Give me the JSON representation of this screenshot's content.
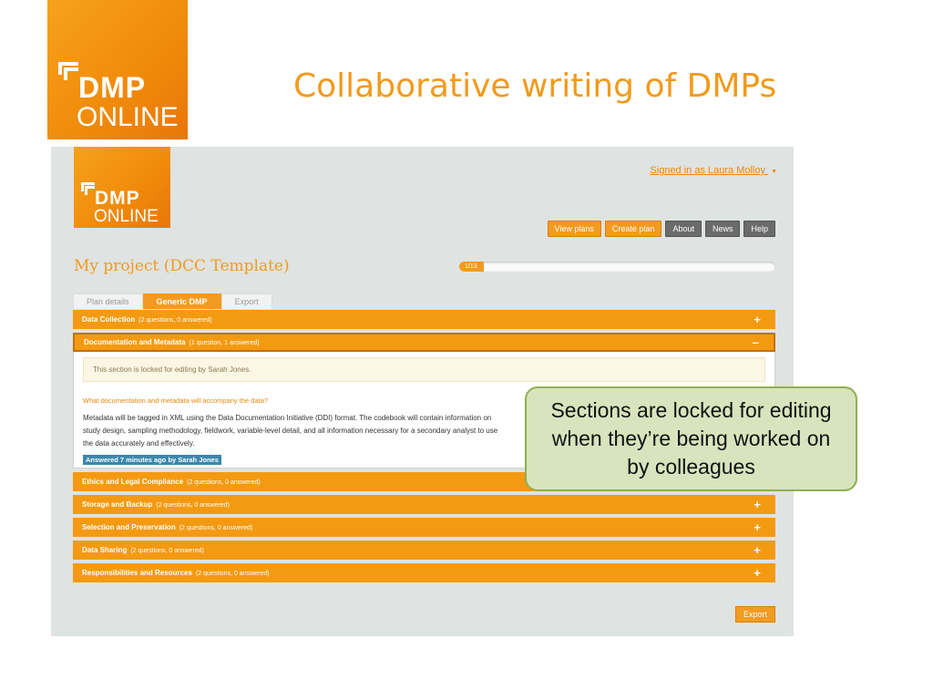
{
  "slide": {
    "title": "Collaborative writing of DMPs",
    "logo": {
      "text_top": "DMP",
      "text_bottom": "ONLINE"
    }
  },
  "screenshot": {
    "logo": {
      "text_top": "DMP",
      "text_bottom": "ONLINE"
    },
    "signed_in": "Signed in as Laura Molloy",
    "nav": [
      {
        "label": "View plans",
        "style": "orange"
      },
      {
        "label": "Create plan",
        "style": "orange"
      },
      {
        "label": "About",
        "style": "grey"
      },
      {
        "label": "News",
        "style": "grey"
      },
      {
        "label": "Help",
        "style": "grey"
      }
    ],
    "project_title": "My project (DCC Template)",
    "progress": {
      "label": "1/13",
      "fraction": 0.077
    },
    "tabs": [
      {
        "label": "Plan details",
        "active": false
      },
      {
        "label": "Generic DMP",
        "active": true
      },
      {
        "label": "Export",
        "active": false
      }
    ],
    "sections": [
      {
        "name": "Data Collection",
        "count": "(2 questions, 0 answered)",
        "toggle": "+"
      },
      {
        "name": "Documentation and Metadata",
        "count": "(1 question, 1 answered)",
        "toggle": "–"
      },
      {
        "name": "Ethics and Legal Compliance",
        "count": "(2 questions, 0 answered)",
        "toggle": "+"
      },
      {
        "name": "Storage and Backup",
        "count": "(2 questions, 0 answered)",
        "toggle": "+"
      },
      {
        "name": "Selection and Preservation",
        "count": "(2 questions, 0 answered)",
        "toggle": "+"
      },
      {
        "name": "Data Sharing",
        "count": "(2 questions, 0 answered)",
        "toggle": "+"
      },
      {
        "name": "Responsibilities and Resources",
        "count": "(2 questions, 0 answered)",
        "toggle": "+"
      }
    ],
    "open_section": {
      "lock_note": "This section is locked for editing by Sarah Jones.",
      "question": "What documentation and metadata will accompany the data?",
      "answer": "Metadata will be tagged in XML using the Data Documentation Initiative (DDI) format. The codebook will contain information on study design, sampling methodology, fieldwork, variable-level detail, and all information necessary for a secondary analyst to use the data accurately and effectively.",
      "answered_badge": "Answered 7 minutes ago by Sarah Jones"
    },
    "export_button": "Export"
  },
  "callout": {
    "text": "Sections are locked for editing when they’re being worked on by colleagues"
  },
  "colors": {
    "brand_orange": "#f39a12",
    "title_orange": "#f29a1c",
    "callout_fill": "#d7e4bd",
    "callout_border": "#8fb04f",
    "badge_blue": "#3a87ad"
  }
}
